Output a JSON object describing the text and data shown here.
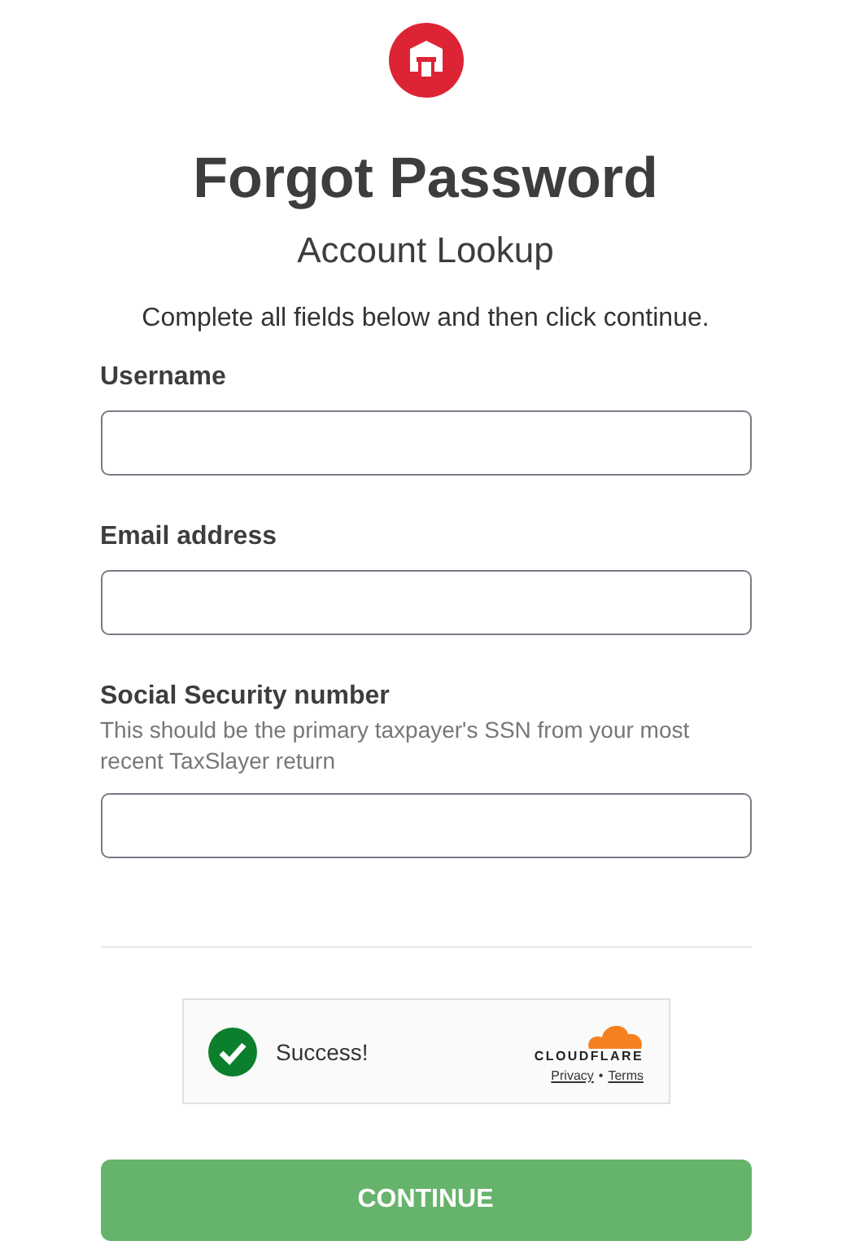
{
  "title": "Forgot Password",
  "subtitle": "Account Lookup",
  "instruction": "Complete all fields below and then click continue.",
  "fields": [
    {
      "label": "Username"
    },
    {
      "label": "Email address"
    },
    {
      "label": "Social Security number",
      "hint": "This should be the primary taxpayer's SSN from your most recent TaxSlayer return"
    }
  ],
  "captcha": {
    "status": "Success!",
    "checked": true,
    "brand": "CLOUDFLARE",
    "links": [
      "Privacy",
      "Terms"
    ],
    "separator": "•"
  },
  "button": "CONTINUE"
}
